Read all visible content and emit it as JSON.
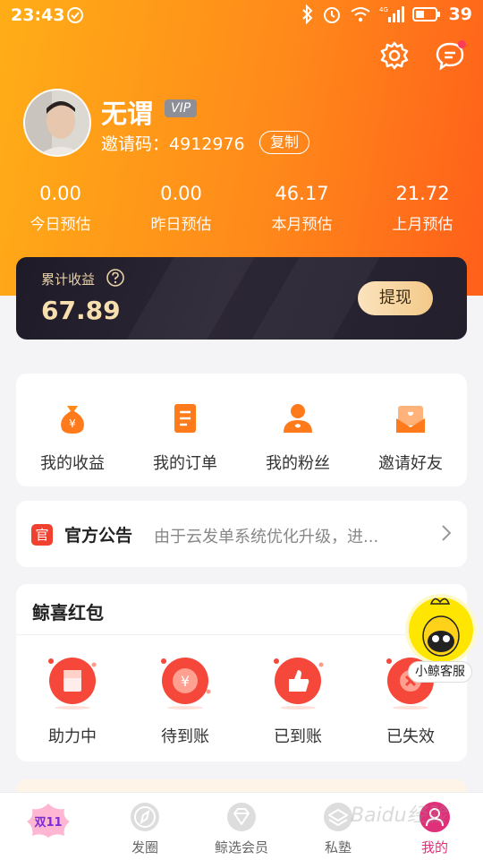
{
  "status_bar": {
    "time": "23:43",
    "battery": "39",
    "net": "4G"
  },
  "header": {
    "username": "无谓",
    "vip_badge": "VIP",
    "invite_label": "邀请码：",
    "invite_code": "4912976",
    "copy_label": "复制",
    "settings_icon": "gear-icon",
    "message_icon": "chat-icon"
  },
  "stats": [
    {
      "value": "0.00",
      "label": "今日预估"
    },
    {
      "value": "0.00",
      "label": "昨日预估"
    },
    {
      "value": "46.17",
      "label": "本月预估"
    },
    {
      "value": "21.72",
      "label": "上月预估"
    }
  ],
  "earnings": {
    "label": "累计收益",
    "value": "67.89",
    "withdraw_label": "提现"
  },
  "menu": [
    {
      "label": "我的收益",
      "icon": "money-bag-icon"
    },
    {
      "label": "我的订单",
      "icon": "order-list-icon"
    },
    {
      "label": "我的粉丝",
      "icon": "fans-icon"
    },
    {
      "label": "邀请好友",
      "icon": "invite-envelope-icon"
    }
  ],
  "notice": {
    "tag": "官",
    "title": "官方公告",
    "text": "由于云发单系统优化升级，进..."
  },
  "red_packets": {
    "title": "鲸喜红包",
    "items": [
      {
        "label": "助力中",
        "icon": "packet-assist-icon"
      },
      {
        "label": "待到账",
        "icon": "packet-yuan-icon"
      },
      {
        "label": "已到账",
        "icon": "packet-thumb-icon"
      },
      {
        "label": "已失效",
        "icon": "packet-expired-icon"
      }
    ]
  },
  "service": {
    "label": "小鲸客服"
  },
  "tabbar": [
    {
      "label": "",
      "badge": "双11",
      "icon": "double-11-icon"
    },
    {
      "label": "发圈",
      "icon": "compass-icon"
    },
    {
      "label": "鲸选会员",
      "icon": "diamond-icon"
    },
    {
      "label": "私塾",
      "icon": "book-stack-icon"
    },
    {
      "label": "我的",
      "icon": "profile-icon",
      "active": true
    }
  ],
  "watermark": "Baidu经验",
  "colors": {
    "header_start": "#ffad17",
    "header_end": "#ff5f1a",
    "accent": "#f04030",
    "active_tab": "#e0307a"
  }
}
